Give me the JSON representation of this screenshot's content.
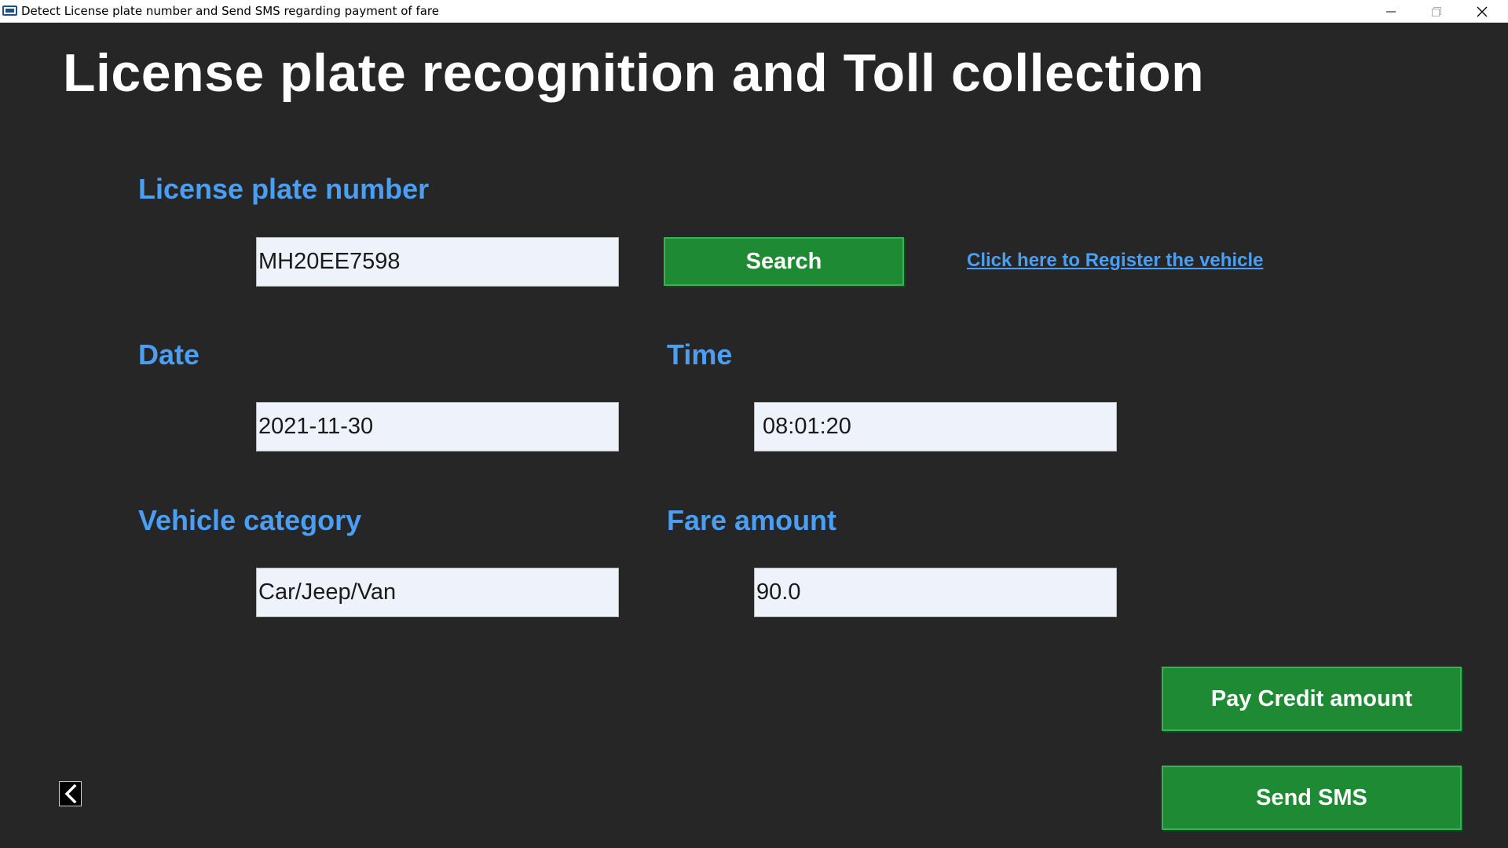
{
  "window": {
    "title": "Detect License plate number and Send SMS regarding payment of fare",
    "icon": "license-plate-app-icon",
    "controls": [
      "minimize-icon",
      "maximize-icon",
      "close-icon"
    ]
  },
  "heading": "License plate recognition and Toll collection",
  "plate": {
    "label": "License plate number",
    "value": "MH20EE7598"
  },
  "search_button": "Search",
  "register_link": "Click here to Register the vehicle",
  "date": {
    "label": "Date",
    "value": "2021-11-30"
  },
  "time": {
    "label": "Time",
    "value": "08:01:20"
  },
  "vehicle_category": {
    "label": "Vehicle category",
    "value": "Car/Jeep/Van"
  },
  "fare": {
    "label": "Fare amount",
    "value": "90.0"
  },
  "pay_button": "Pay Credit amount",
  "sms_button": "Send SMS",
  "back_icon": "chevron-left-icon",
  "colors": {
    "background": "#262626",
    "label": "#4a9ff5",
    "button": "#1f8a34",
    "field": "#eef3fb"
  }
}
